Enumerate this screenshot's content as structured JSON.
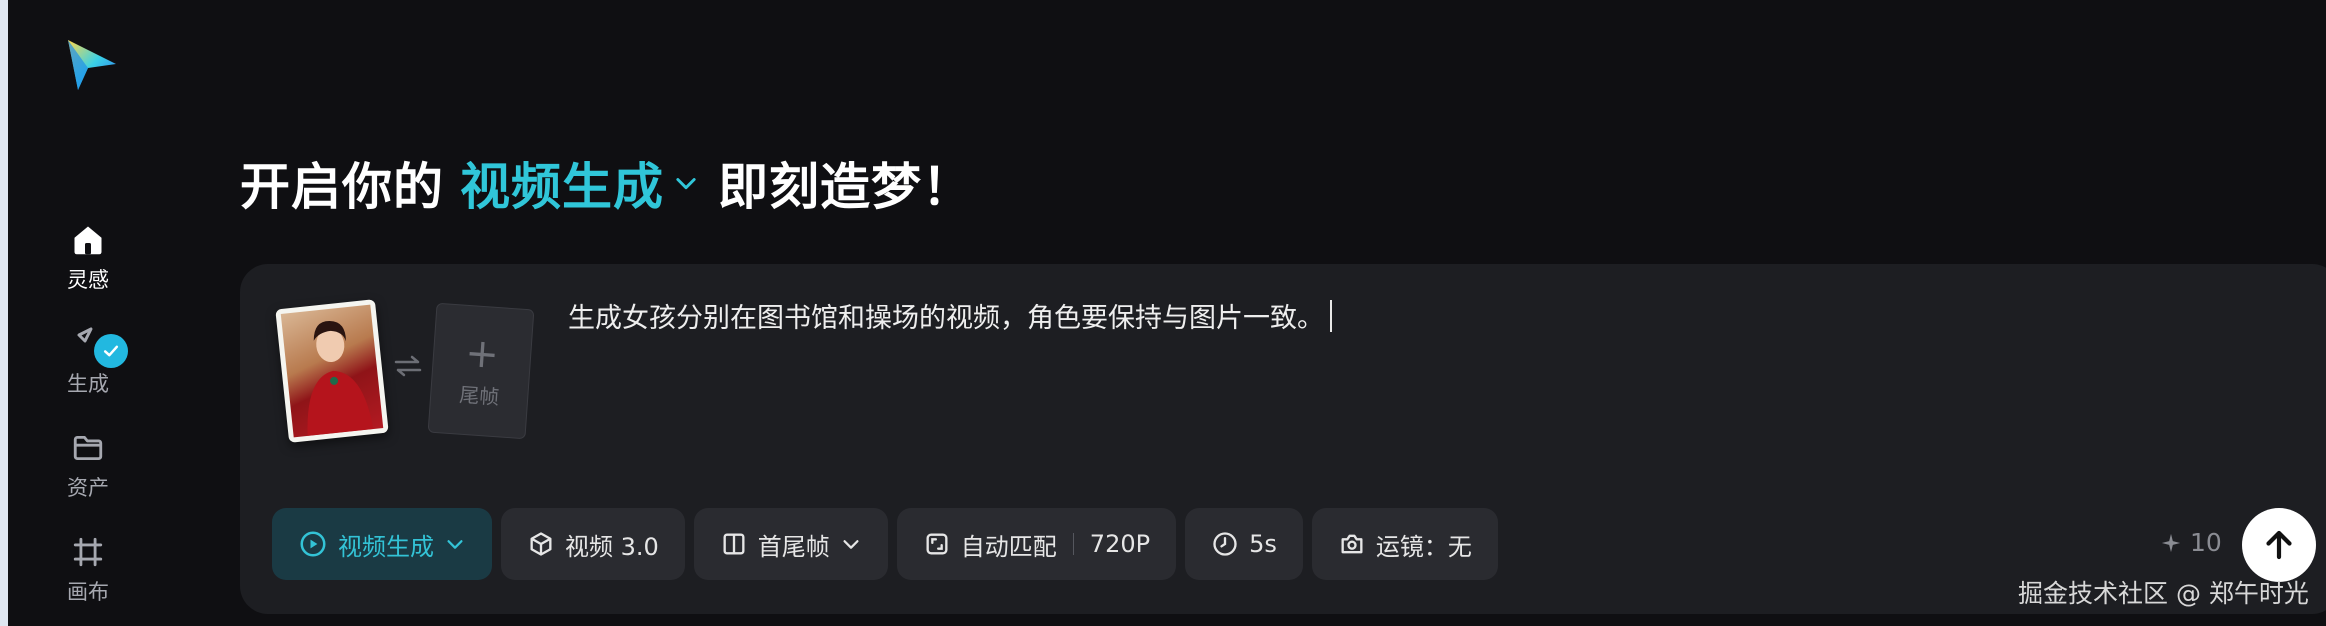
{
  "sidebar": {
    "items": [
      {
        "label": "灵感",
        "icon": "home-icon",
        "active": true
      },
      {
        "label": "生成",
        "icon": "generate-icon",
        "active": false
      },
      {
        "label": "资产",
        "icon": "folder-icon",
        "active": false
      },
      {
        "label": "画布",
        "icon": "canvas-icon",
        "active": false
      }
    ]
  },
  "headline": {
    "prefix": "开启你的",
    "mode": "视频生成",
    "suffix": "即刻造梦！"
  },
  "frames": {
    "last_frame_label": "尾帧",
    "add_symbol": "+"
  },
  "prompt": {
    "text": "生成女孩分别在图书馆和操场的视频，角色要保持与图片一致。"
  },
  "toolbar": {
    "mode_label": "视频生成",
    "model_label": "视频 3.0",
    "frames_label": "首尾帧",
    "ratio_label": "自动匹配",
    "resolution_label": "720P",
    "duration_label": "5s",
    "camera_label": "运镜：无"
  },
  "credits": {
    "value": "10",
    "icon": "sparkle-icon"
  },
  "watermark": {
    "text": "掘金技术社区 @ 郑午时光"
  },
  "colors": {
    "accent": "#30c6d9",
    "background": "#0f0f12",
    "panel": "#1d1e22",
    "chip": "#2a2b30"
  }
}
